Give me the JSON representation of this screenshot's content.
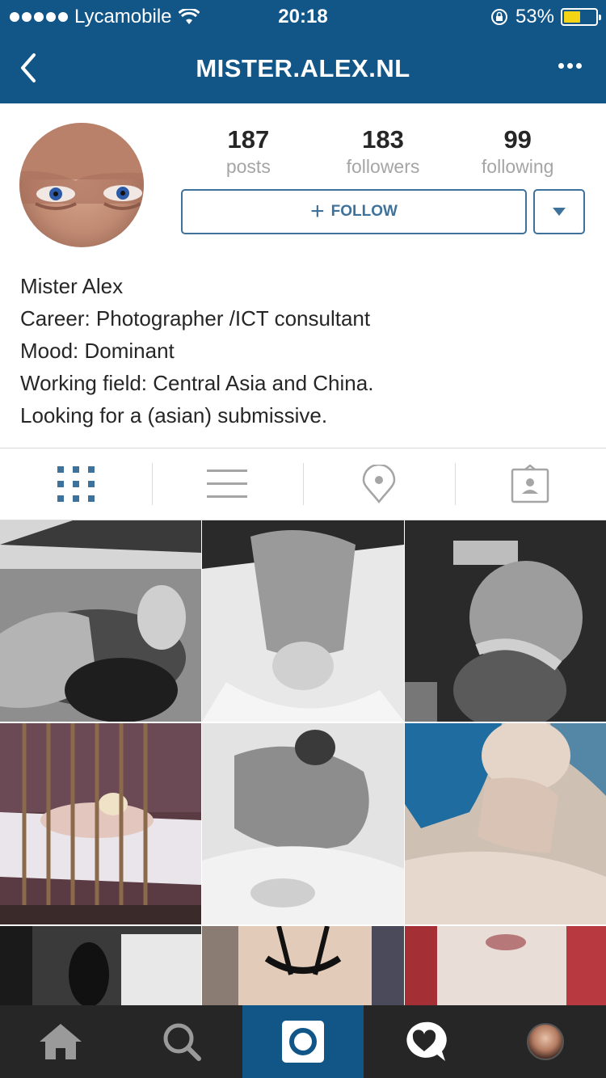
{
  "status_bar": {
    "carrier": "Lycamobile",
    "time": "20:18",
    "battery_percent_text": "53%",
    "battery_level": 0.53,
    "battery_color": "#f5d416"
  },
  "nav": {
    "title": "MISTER.ALEX.NL",
    "back_icon": "chevron-left-icon",
    "more_icon": "more-horizontal-icon",
    "bar_color": "#125688"
  },
  "profile": {
    "stats": [
      {
        "value": "187",
        "label": "posts"
      },
      {
        "value": "183",
        "label": "followers"
      },
      {
        "value": "99",
        "label": "following"
      }
    ],
    "follow_label": "FOLLOW",
    "accent_color": "#3f729b",
    "bio_lines": [
      "Mister Alex",
      "Career: Photographer /ICT consultant",
      "Mood: Dominant",
      "Working field: Central Asia and China.",
      "Looking for a (asian) submissive."
    ]
  },
  "view_tabs": [
    {
      "name": "grid-view",
      "icon": "grid-icon",
      "active": true
    },
    {
      "name": "list-view",
      "icon": "list-icon",
      "active": false
    },
    {
      "name": "map-view",
      "icon": "location-pin-icon",
      "active": false
    },
    {
      "name": "tagged-view",
      "icon": "tagged-photos-icon",
      "active": false
    }
  ],
  "photo_count_visible": 9,
  "tab_bar": [
    {
      "name": "home",
      "icon": "home-icon"
    },
    {
      "name": "search",
      "icon": "search-icon"
    },
    {
      "name": "camera",
      "icon": "camera-icon",
      "active": true
    },
    {
      "name": "activity",
      "icon": "heart-bubble-icon"
    },
    {
      "name": "profile",
      "icon": "profile-avatar-icon"
    }
  ]
}
